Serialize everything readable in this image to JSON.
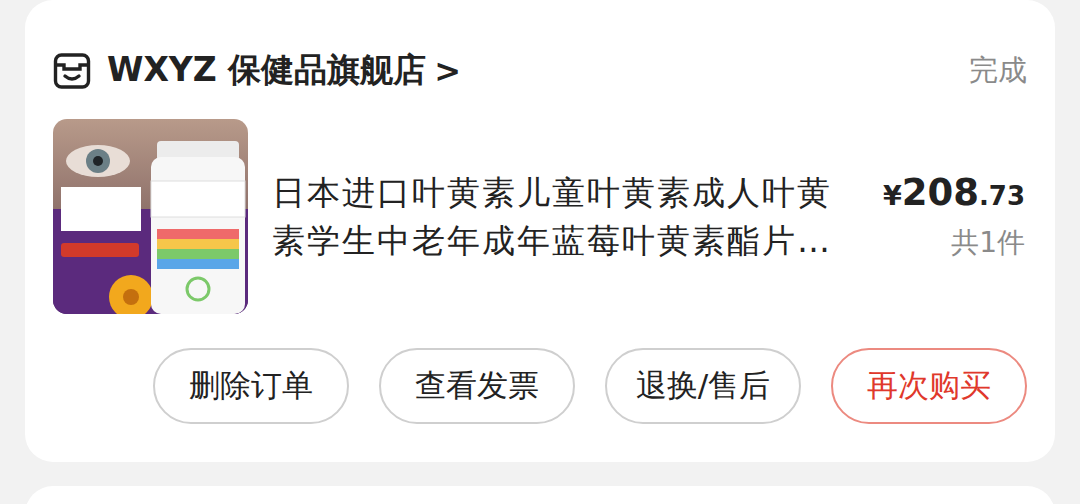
{
  "store": {
    "name": "WXYZ 保健品旗舰店",
    "chevron": ">"
  },
  "status": "完成",
  "product": {
    "title_lines": [
      "日本进口叶黄素儿童叶黄素成人叶黄",
      "素学生中老年成年蓝莓叶黄素酯片…"
    ],
    "price": {
      "currency": "¥",
      "integer": "208",
      "decimal": ".73"
    },
    "quantity": "共1件"
  },
  "buttons": [
    {
      "label": "删除订单",
      "kind": "default"
    },
    {
      "label": "查看发票",
      "kind": "default"
    },
    {
      "label": "退换/售后",
      "kind": "default"
    },
    {
      "label": "再次购买",
      "kind": "primary"
    }
  ]
}
